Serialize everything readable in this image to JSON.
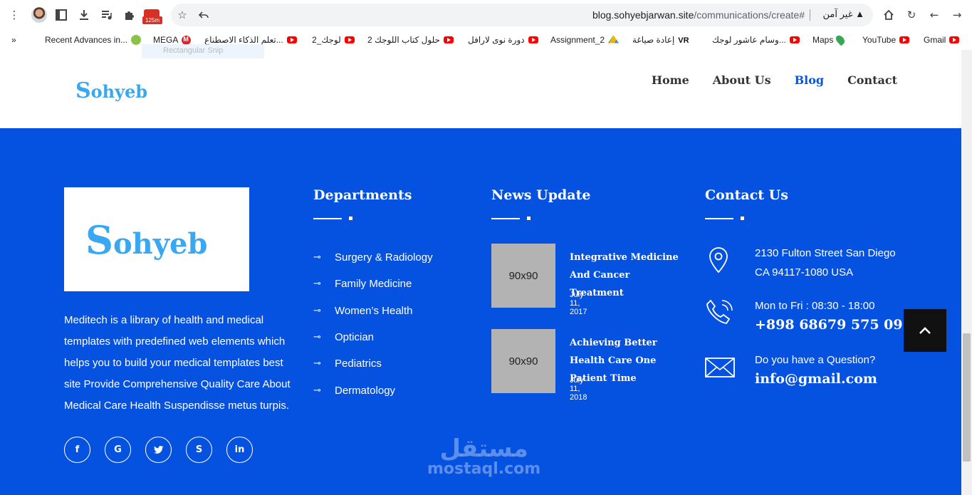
{
  "browser": {
    "url_domain": "blog.sohyebjarwan.site",
    "url_path": "/communications/create#",
    "security_text": "غير آمن",
    "extension_badge": "125m",
    "bookmarks": [
      "Gmail",
      "YouTube",
      "Maps",
      "وسام عاشور لوجك...",
      "إعادة صياغة",
      "Assignment_2",
      "دورة نوى لارافل",
      "حلول كتاب اللوجك 2",
      "لوجك_2",
      "تعلم الذكاء الاصطناع...",
      "MEGA",
      "Recent Advances in..."
    ],
    "overflow": "»",
    "snip_hint": "Rectangular Snip"
  },
  "site": {
    "logo": {
      "initial": "S",
      "rest": "ohyeb"
    },
    "nav": [
      {
        "label": "Home",
        "active": false
      },
      {
        "label": "About Us",
        "active": false
      },
      {
        "label": "Blog",
        "active": true
      },
      {
        "label": "Contact",
        "active": false
      }
    ]
  },
  "footer": {
    "about_text": "Meditech is a library of health and medical templates with predefined web elements which helps you to build your medical templates best site Provide Comprehensive Quality Care About Medical Care Health Suspendisse metus turpis.",
    "socials": [
      "f",
      "G",
      "t",
      "S",
      "in"
    ],
    "departments_title": "Departments",
    "departments": [
      "Surgery & Radiology",
      "Family Medicine",
      "Women’s Health",
      "Optician",
      "Pediatrics",
      "Dermatology"
    ],
    "news_title": "News Update",
    "news": [
      {
        "thumb": "90x90",
        "title": "Integrative Medicine And Cancer Treatment",
        "date": "July 11, 2017"
      },
      {
        "thumb": "90x90",
        "title": "Achieving Better Health Care One Patient Time",
        "date": "July 11, 2018"
      }
    ],
    "contact_title": "Contact Us",
    "address_line1": "2130 Fulton Street San Diego",
    "address_line2": "CA 94117-1080 USA",
    "hours": "Mon to Fri : 08:30 - 18:00",
    "phone": "+898 68679 575 09",
    "question": "Do you have a Question?",
    "email": "info@gmail.com"
  },
  "watermark": {
    "arabic": "مستقل",
    "latin": "mostaql.com"
  }
}
